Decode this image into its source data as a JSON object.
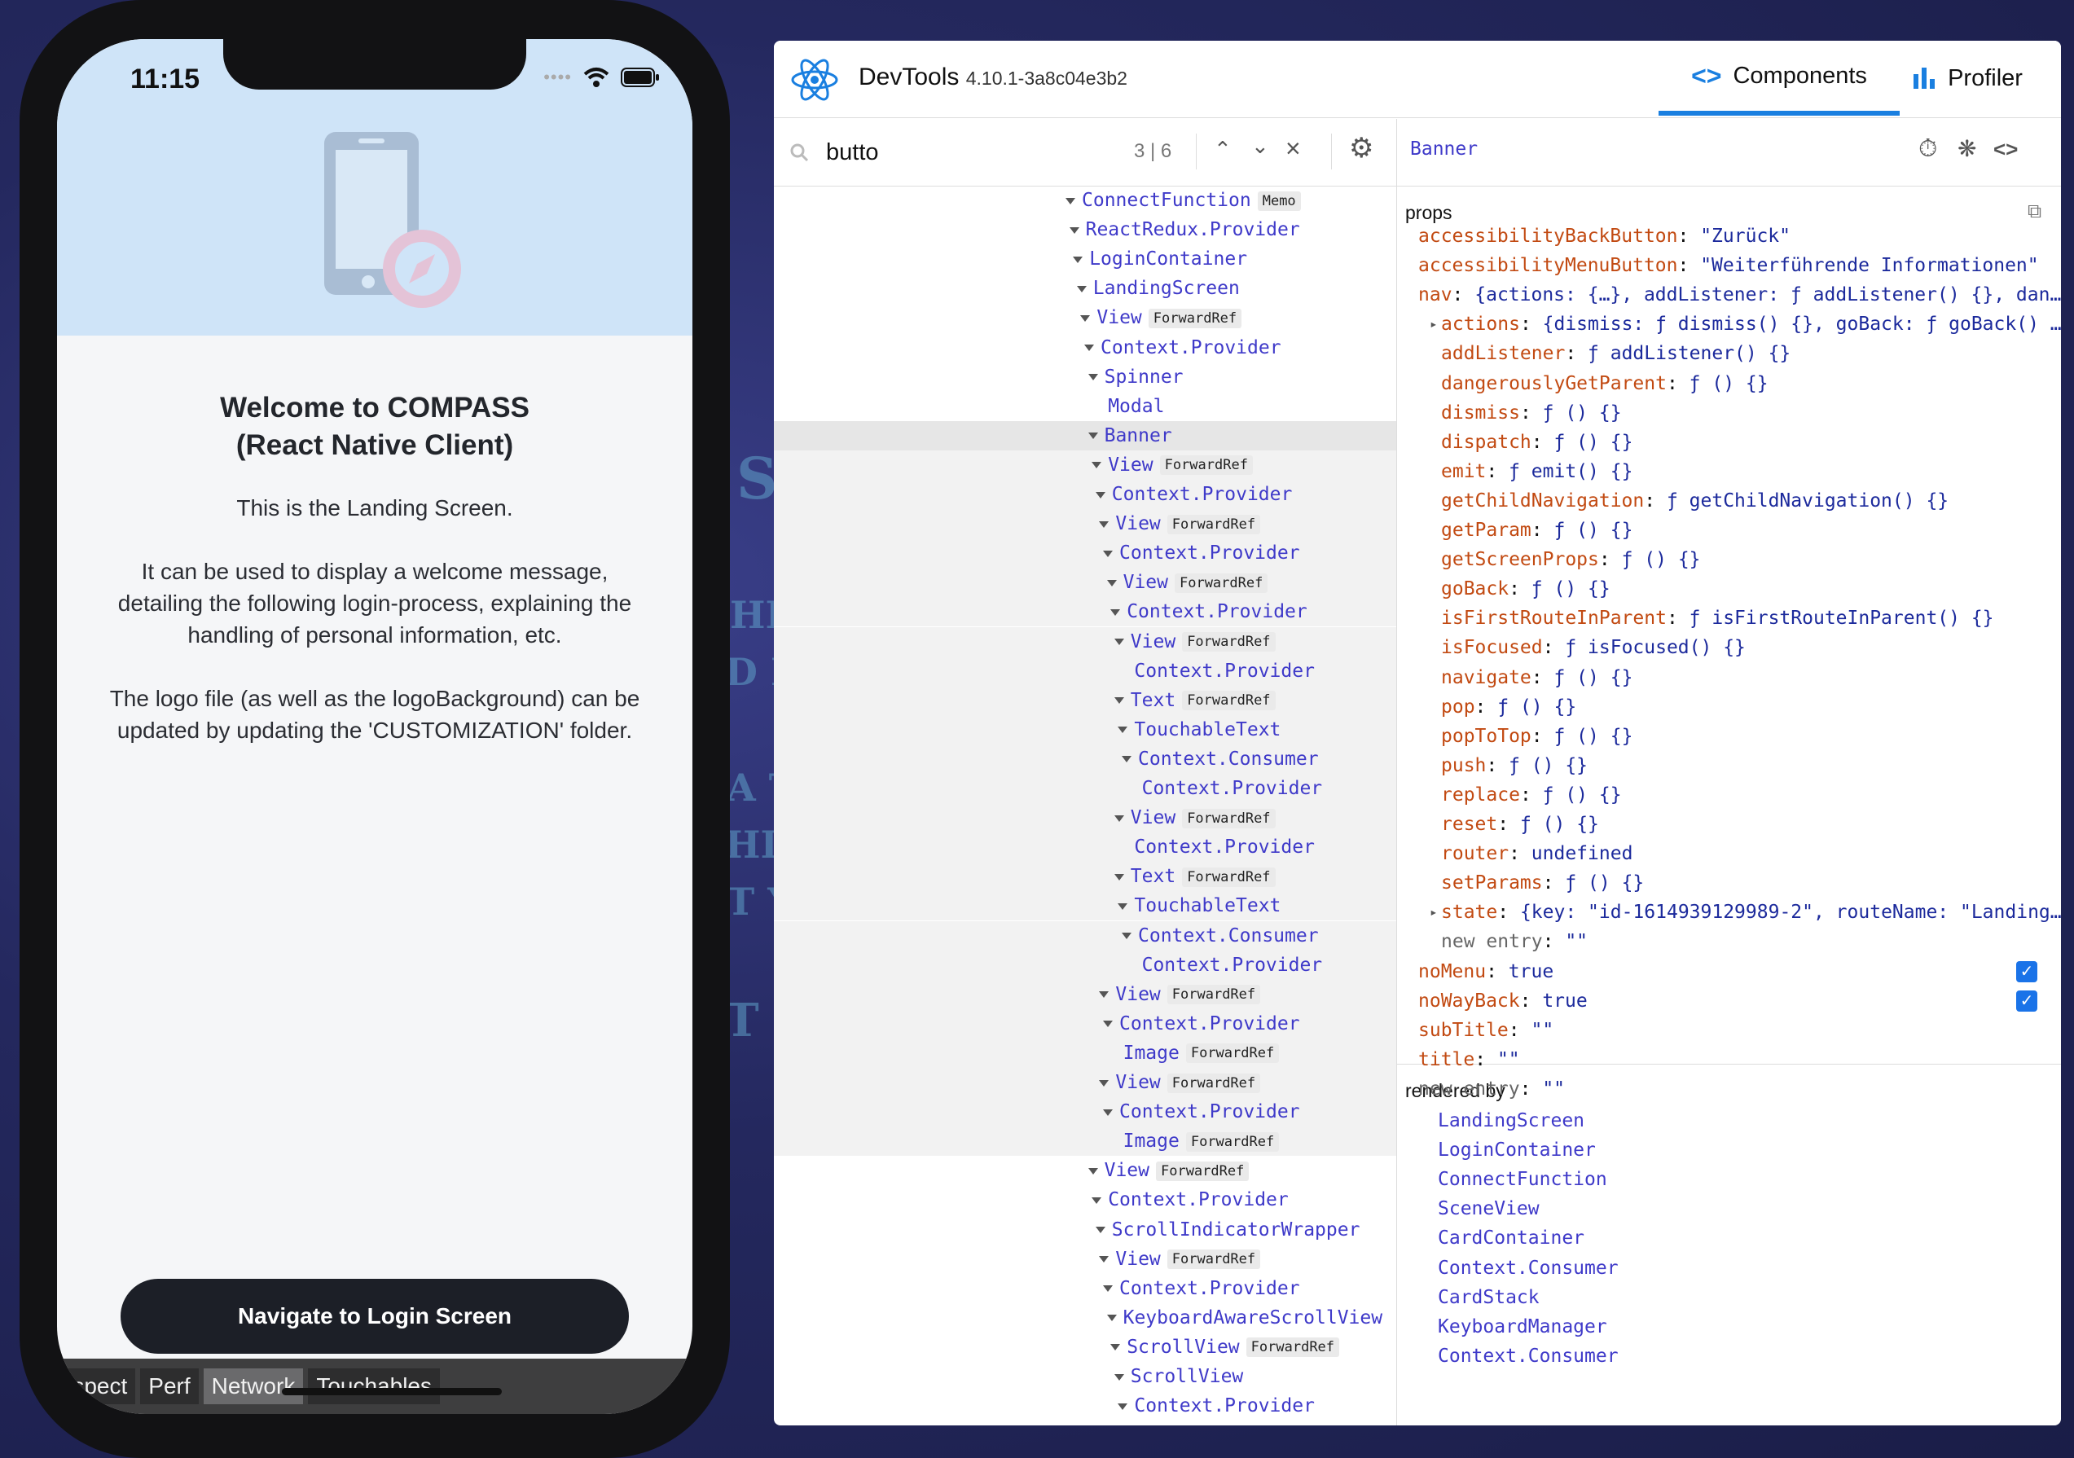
{
  "phone": {
    "status": {
      "time": "11:15"
    },
    "welcome_title": "Welcome to COMPASS\n(React Native Client)",
    "landing_text": "This is the Landing Screen.\n\nIt can be used to display a welcome message, detailing the following login-process, explaining the handling of personal information, etc.\n\nThe logo file (as well as the logoBackground) can be updated by updating the 'CUSTOMIZATION' folder.",
    "nav_button_label": "Navigate to Login Screen",
    "devbar": [
      "Inspect",
      "Perf",
      "Network",
      "Touchables"
    ],
    "devbar_active": "Network"
  },
  "devtools": {
    "title": "DevTools",
    "version": "4.10.1-3a8c04e3b2",
    "tabs": {
      "components": "Components",
      "profiler": "Profiler"
    },
    "search": {
      "value": "butto",
      "count": "3 | 6"
    },
    "tree": [
      {
        "name": "ConnectFunction",
        "badge": "Memo",
        "indent": 0,
        "arrow": true
      },
      {
        "name": "ReactRedux.Provider",
        "indent": 1,
        "arrow": true
      },
      {
        "name": "LoginContainer",
        "indent": 2,
        "arrow": true
      },
      {
        "name": "LandingScreen",
        "indent": 3,
        "arrow": true
      },
      {
        "name": "View",
        "badge": "ForwardRef",
        "indent": 4,
        "arrow": true
      },
      {
        "name": "Context.Provider",
        "indent": 5,
        "arrow": true
      },
      {
        "name": "Spinner",
        "indent": 6,
        "arrow": true
      },
      {
        "name": "Modal",
        "indent": 7,
        "arrow": false
      },
      {
        "name": "Banner",
        "indent": 6,
        "arrow": true,
        "selected": true
      },
      {
        "name": "View",
        "badge": "ForwardRef",
        "indent": 7,
        "arrow": true,
        "dim": true
      },
      {
        "name": "Context.Provider",
        "indent": 8,
        "arrow": true,
        "dim": true
      },
      {
        "name": "View",
        "badge": "ForwardRef",
        "indent": 9,
        "arrow": true,
        "dim": true
      },
      {
        "name": "Context.Provider",
        "indent": 10,
        "arrow": true,
        "dim": true
      },
      {
        "name": "View",
        "badge": "ForwardRef",
        "indent": 11,
        "arrow": true,
        "dim": true
      },
      {
        "name": "Context.Provider",
        "indent": 12,
        "arrow": true,
        "dim": true
      },
      {
        "name": "View",
        "badge": "ForwardRef",
        "indent": 13,
        "arrow": true,
        "dim": true
      },
      {
        "name": "Context.Provider",
        "indent": 14,
        "arrow": false,
        "dim": true
      },
      {
        "name": "Text",
        "badge": "ForwardRef",
        "indent": 13,
        "arrow": true,
        "dim": true
      },
      {
        "name": "TouchableText",
        "indent": 14,
        "arrow": true,
        "dim": true
      },
      {
        "name": "Context.Consumer",
        "indent": 15,
        "arrow": true,
        "dim": true
      },
      {
        "name": "Context.Provider",
        "indent": 16,
        "arrow": false,
        "dim": true
      },
      {
        "name": "View",
        "badge": "ForwardRef",
        "indent": 13,
        "arrow": true,
        "dim": true
      },
      {
        "name": "Context.Provider",
        "indent": 14,
        "arrow": false,
        "dim": true
      },
      {
        "name": "Text",
        "badge": "ForwardRef",
        "indent": 13,
        "arrow": true,
        "dim": true
      },
      {
        "name": "TouchableText",
        "indent": 14,
        "arrow": true,
        "dim": true
      },
      {
        "name": "Context.Consumer",
        "indent": 15,
        "arrow": true,
        "dim": true
      },
      {
        "name": "Context.Provider",
        "indent": 16,
        "arrow": false,
        "dim": true
      },
      {
        "name": "View",
        "badge": "ForwardRef",
        "indent": 9,
        "arrow": true,
        "dim": true
      },
      {
        "name": "Context.Provider",
        "indent": 10,
        "arrow": true,
        "dim": true
      },
      {
        "name": "Image",
        "badge": "ForwardRef",
        "indent": 11,
        "arrow": false,
        "dim": true
      },
      {
        "name": "View",
        "badge": "ForwardRef",
        "indent": 9,
        "arrow": true,
        "dim": true
      },
      {
        "name": "Context.Provider",
        "indent": 10,
        "arrow": true,
        "dim": true
      },
      {
        "name": "Image",
        "badge": "ForwardRef",
        "indent": 11,
        "arrow": false,
        "dim": true
      },
      {
        "name": "View",
        "badge": "ForwardRef",
        "indent": 6,
        "arrow": true
      },
      {
        "name": "Context.Provider",
        "indent": 7,
        "arrow": true
      },
      {
        "name": "ScrollIndicatorWrapper",
        "indent": 8,
        "arrow": true
      },
      {
        "name": "View",
        "badge": "ForwardRef",
        "indent": 9,
        "arrow": true
      },
      {
        "name": "Context.Provider",
        "indent": 10,
        "arrow": true
      },
      {
        "name": "KeyboardAwareScrollView",
        "indent": 11,
        "arrow": true
      },
      {
        "name": "ScrollView",
        "badge": "ForwardRef",
        "indent": 12,
        "arrow": true
      },
      {
        "name": "ScrollView",
        "indent": 13,
        "arrow": true
      },
      {
        "name": "Context.Provider",
        "indent": 14,
        "arrow": true
      }
    ],
    "selected_component": "Banner",
    "props_label": "props",
    "props": [
      {
        "key": "accessibilityBackButton",
        "value": "\"Zurück\"",
        "indent": 0
      },
      {
        "key": "accessibilityMenuButton",
        "value": "\"Weiterführende Informationen\"",
        "indent": 0
      },
      {
        "key": "nav",
        "value": "{actions: {…}, addListener: ƒ addListener() {}, dan…",
        "indent": 0,
        "arrow": "down"
      },
      {
        "key": "actions",
        "value": "{dismiss: ƒ dismiss() {}, goBack: ƒ goBack() …",
        "indent": 1,
        "arrow": "right"
      },
      {
        "key": "addListener",
        "value": "ƒ addListener() {}",
        "indent": 1
      },
      {
        "key": "dangerouslyGetParent",
        "value": "ƒ () {}",
        "indent": 1
      },
      {
        "key": "dismiss",
        "value": "ƒ () {}",
        "indent": 1
      },
      {
        "key": "dispatch",
        "value": "ƒ () {}",
        "indent": 1
      },
      {
        "key": "emit",
        "value": "ƒ emit() {}",
        "indent": 1
      },
      {
        "key": "getChildNavigation",
        "value": "ƒ getChildNavigation() {}",
        "indent": 1
      },
      {
        "key": "getParam",
        "value": "ƒ () {}",
        "indent": 1
      },
      {
        "key": "getScreenProps",
        "value": "ƒ () {}",
        "indent": 1
      },
      {
        "key": "goBack",
        "value": "ƒ () {}",
        "indent": 1
      },
      {
        "key": "isFirstRouteInParent",
        "value": "ƒ isFirstRouteInParent() {}",
        "indent": 1
      },
      {
        "key": "isFocused",
        "value": "ƒ isFocused() {}",
        "indent": 1
      },
      {
        "key": "navigate",
        "value": "ƒ () {}",
        "indent": 1
      },
      {
        "key": "pop",
        "value": "ƒ () {}",
        "indent": 1
      },
      {
        "key": "popToTop",
        "value": "ƒ () {}",
        "indent": 1
      },
      {
        "key": "push",
        "value": "ƒ () {}",
        "indent": 1
      },
      {
        "key": "replace",
        "value": "ƒ () {}",
        "indent": 1
      },
      {
        "key": "reset",
        "value": "ƒ () {}",
        "indent": 1
      },
      {
        "key": "router",
        "value": "undefined",
        "indent": 1
      },
      {
        "key": "setParams",
        "value": "ƒ () {}",
        "indent": 1
      },
      {
        "key": "state",
        "value": "{key: \"id-1614939129989-2\", routeName: \"Landing…",
        "indent": 1,
        "arrow": "right"
      },
      {
        "key": "new entry",
        "value": "\"\"",
        "indent": 1,
        "gray": true
      },
      {
        "key": "noMenu",
        "value": "true",
        "indent": 0,
        "checkbox": true
      },
      {
        "key": "noWayBack",
        "value": "true",
        "indent": 0,
        "checkbox": true
      },
      {
        "key": "subTitle",
        "value": "\"\"",
        "indent": 0
      },
      {
        "key": "title",
        "value": "\"\"",
        "indent": 0
      },
      {
        "key": "new entry",
        "value": "\"\"",
        "indent": 0,
        "gray": true
      }
    ],
    "rendered_by_label": "rendered by",
    "rendered_by": [
      "LandingScreen",
      "LoginContainer",
      "ConnectFunction",
      "SceneView",
      "CardContainer",
      "Context.Consumer",
      "CardStack",
      "KeyboardManager",
      "Context.Consumer"
    ]
  },
  "background_words": [
    "SI",
    "HER",
    "D IT'",
    "A TA",
    "HIT S",
    "T YO",
    "T TO"
  ],
  "colors": {
    "accent": "#1a7fe0",
    "component": "#3f3ac9",
    "prop_key": "#c24a12",
    "prop_value": "#1c2a9c",
    "hero": "#cfe4f8"
  }
}
